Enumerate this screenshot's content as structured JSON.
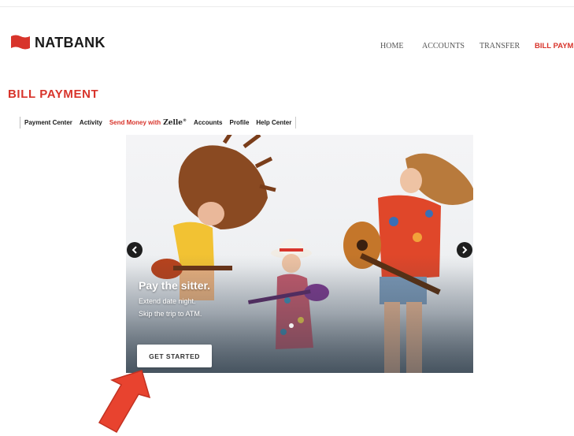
{
  "brand": {
    "name": "NATBANK",
    "logo_icon": "flag-logo-icon",
    "color": "#d8342b"
  },
  "nav": {
    "items": [
      {
        "label": "HOME"
      },
      {
        "label": "ACCOUNTS"
      },
      {
        "label": "TRANSFER"
      },
      {
        "label": "BILL PAYMENT"
      }
    ],
    "active_index": 3
  },
  "page": {
    "title": "BILL PAYMENT"
  },
  "subtabs": {
    "payment_center": "Payment Center",
    "activity": "Activity",
    "send_money": "Send Money with",
    "zelle": "Zelle",
    "zelle_mark": "®",
    "accounts": "Accounts",
    "profile": "Profile",
    "help_center": "Help Center"
  },
  "hero": {
    "headline": "Pay the sitter.",
    "line1": "Extend date night.",
    "line2": "Skip the trip to ATM.",
    "cta": "GET STARTED",
    "prev_icon": "chevron-left-icon",
    "next_icon": "chevron-right-icon"
  },
  "annotation": {
    "color": "#e8432f",
    "icon": "red-arrow-pointer"
  }
}
